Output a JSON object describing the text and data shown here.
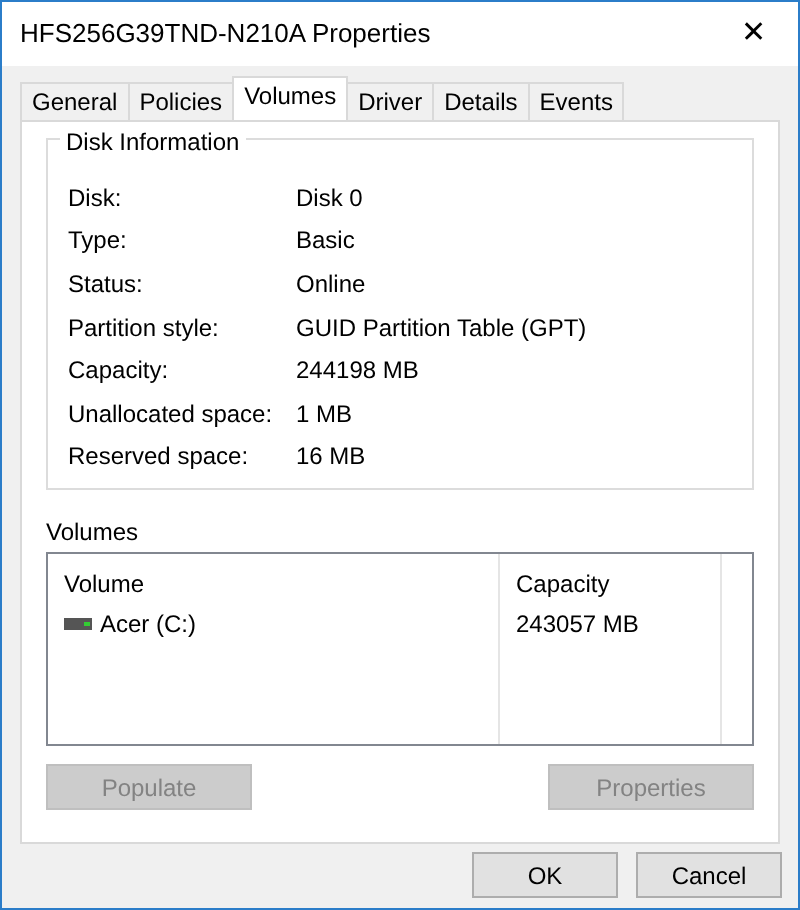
{
  "window": {
    "title": "HFS256G39TND-N210A Properties",
    "close": "✕"
  },
  "tabs": [
    {
      "label": "General",
      "selected": false
    },
    {
      "label": "Policies",
      "selected": false
    },
    {
      "label": "Volumes",
      "selected": true
    },
    {
      "label": "Driver",
      "selected": false
    },
    {
      "label": "Details",
      "selected": false
    },
    {
      "label": "Events",
      "selected": false
    }
  ],
  "disk_information": {
    "title": "Disk Information",
    "fields": [
      {
        "label": "Disk:",
        "value": "Disk 0"
      },
      {
        "label": "Type:",
        "value": "Basic"
      },
      {
        "label": "Status:",
        "value": "Online"
      },
      {
        "label": "Partition style:",
        "value": "GUID Partition Table (GPT)"
      },
      {
        "label": "Capacity:",
        "value": "244198 MB"
      },
      {
        "label": "Unallocated space:",
        "value": "1 MB"
      },
      {
        "label": "Reserved space:",
        "value": "16 MB"
      }
    ]
  },
  "volumes": {
    "title": "Volumes",
    "columns": [
      "Volume",
      "Capacity"
    ],
    "rows": [
      {
        "volume": "Acer (C:)",
        "capacity": "243057 MB"
      }
    ],
    "buttons": [
      {
        "label": "Populate",
        "disabled": true
      },
      {
        "label": "Properties",
        "disabled": true
      }
    ]
  },
  "dialog_buttons": [
    {
      "label": "OK",
      "disabled": false
    },
    {
      "label": "Cancel",
      "disabled": false
    }
  ]
}
